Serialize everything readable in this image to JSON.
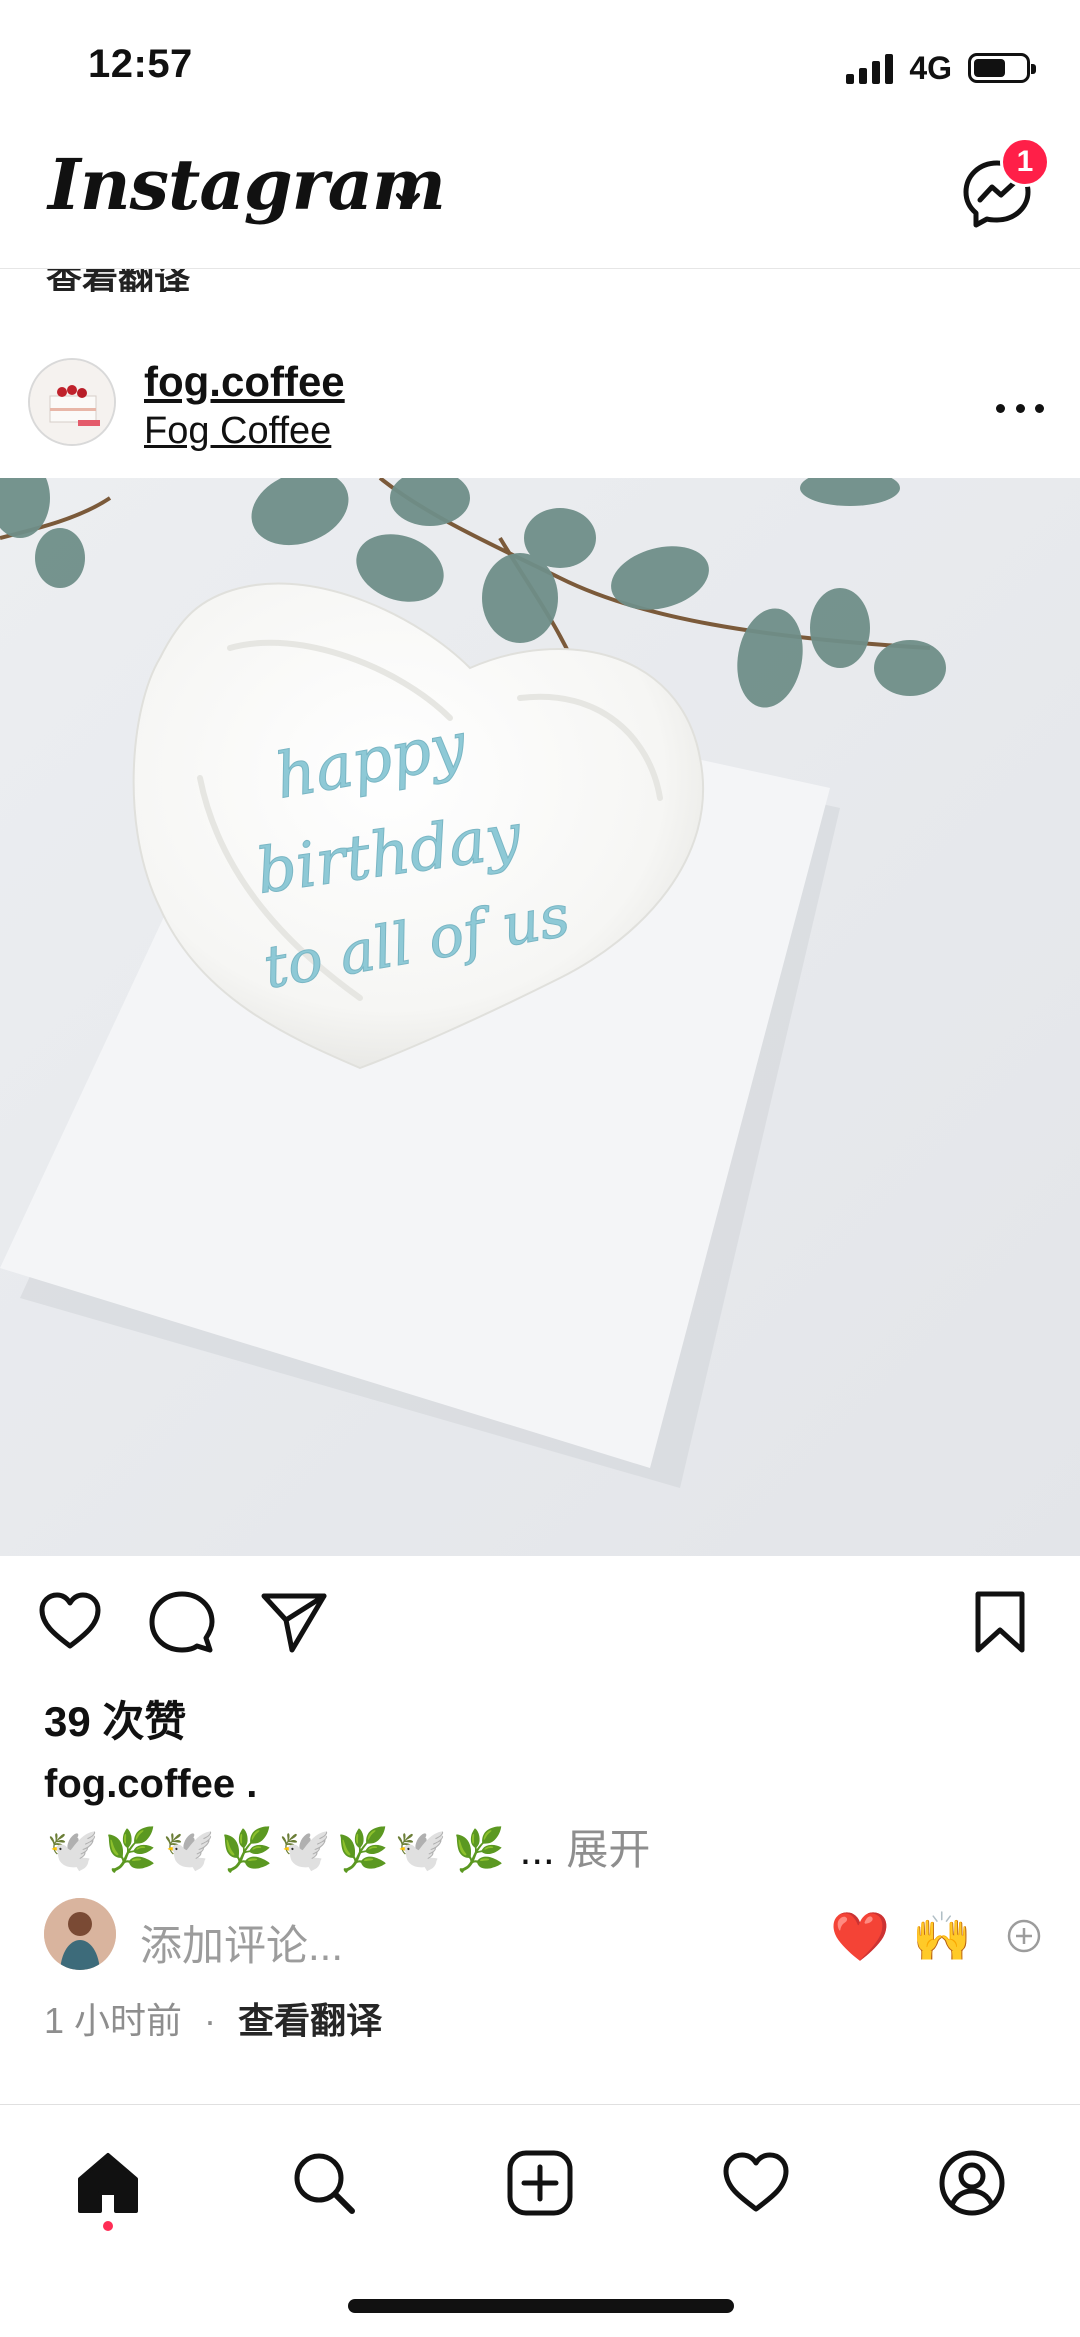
{
  "status_bar": {
    "time": "12:57",
    "network": "4G",
    "battery_level": 0.62
  },
  "header": {
    "logo": "Instagram",
    "messages_badge": "1"
  },
  "peek_text": "查看翻译",
  "post": {
    "username": "fog.coffee",
    "location": "Fog Coffee",
    "image_cake_text": [
      "happy",
      "birthday",
      "to all of us"
    ],
    "likes": "39 次赞",
    "caption_user": "fog.coffee",
    "caption_dot": ".",
    "caption_emojis": [
      "🕊️",
      "🌿",
      "🕊️",
      "🌿",
      "🕊️",
      "🌿",
      "🕊️",
      "🌿"
    ],
    "caption_ellipsis": "...",
    "caption_more": "展开",
    "comment_placeholder": "添加评论...",
    "quick_reactions": [
      "❤️",
      "🙌"
    ],
    "time_ago": "1 小时前",
    "separator": "·",
    "translate": "查看翻译"
  },
  "colors": {
    "badge": "#ff1f48",
    "cake_text": "#8ec9d6",
    "leaves": "#6f8f88",
    "nav_dot": "#ff2d55"
  },
  "icons": {
    "messenger": "messenger-icon",
    "like": "heart-icon",
    "comment": "comment-icon",
    "share": "send-icon",
    "save": "bookmark-icon",
    "nav": [
      "home-icon",
      "search-icon",
      "create-icon",
      "activity-icon",
      "profile-icon"
    ]
  }
}
